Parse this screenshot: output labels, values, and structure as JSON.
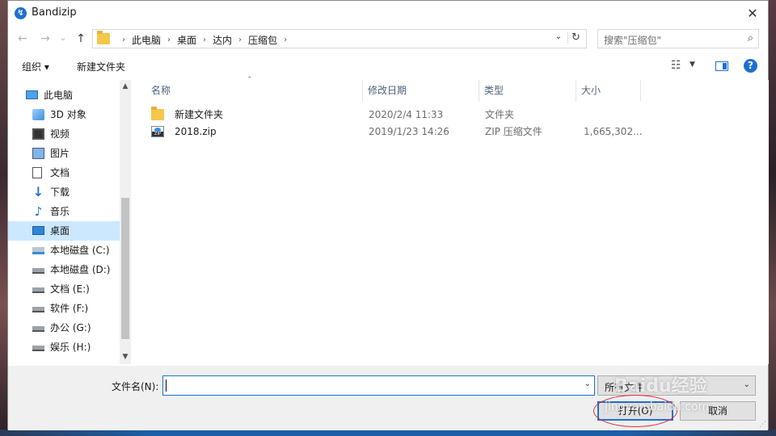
{
  "window": {
    "title": "Bandizip",
    "app_icon": "bandizip-icon",
    "close": "✕"
  },
  "nav": {
    "back": "←",
    "forward": "→",
    "recent": "⌄",
    "up": "↑",
    "breadcrumbs": [
      "此电脑",
      "桌面",
      "达内",
      "压缩包"
    ],
    "refresh": "↻",
    "search_placeholder": "搜索\"压缩包\""
  },
  "toolbar": {
    "organize": "组织 ▾",
    "new_folder": "新建文件夹"
  },
  "sidebar": {
    "items": [
      {
        "label": "此电脑",
        "icon": "computer-icon",
        "root": true
      },
      {
        "label": "3D 对象",
        "icon": "3d-objects-icon"
      },
      {
        "label": "视频",
        "icon": "video-icon"
      },
      {
        "label": "图片",
        "icon": "pictures-icon"
      },
      {
        "label": "文档",
        "icon": "documents-icon"
      },
      {
        "label": "下载",
        "icon": "download-icon"
      },
      {
        "label": "音乐",
        "icon": "music-icon"
      },
      {
        "label": "桌面",
        "icon": "desktop-icon",
        "selected": true
      },
      {
        "label": "本地磁盘 (C:)",
        "icon": "system-drive-icon"
      },
      {
        "label": "本地磁盘 (D:)",
        "icon": "drive-icon"
      },
      {
        "label": "文档 (E:)",
        "icon": "drive-icon"
      },
      {
        "label": "软件 (F:)",
        "icon": "drive-icon"
      },
      {
        "label": "办公 (G:)",
        "icon": "drive-icon"
      },
      {
        "label": "娱乐 (H:)",
        "icon": "drive-icon"
      }
    ]
  },
  "columns": {
    "name": "名称",
    "modified": "修改日期",
    "type": "类型",
    "size": "大小"
  },
  "files": [
    {
      "name": "新建文件夹",
      "modified": "2020/2/4 11:33",
      "type": "文件夹",
      "size": "",
      "icon": "folder-icon"
    },
    {
      "name": "2018.zip",
      "modified": "2019/1/23 14:26",
      "type": "ZIP 压缩文件",
      "size": "1,665,302...",
      "icon": "zip-file-icon"
    }
  ],
  "footer": {
    "filename_label": "文件名(N):",
    "filename_value": "",
    "filetype": "所有文件",
    "open_button": "打开(O)",
    "cancel_button": "取消"
  },
  "watermark": {
    "brand": "Baidu经验",
    "url": "jingyan.baidu.com"
  },
  "colors": {
    "accent": "#1f6fd1",
    "selection": "#cce8ff",
    "highlight_circle": "#e0303a"
  }
}
